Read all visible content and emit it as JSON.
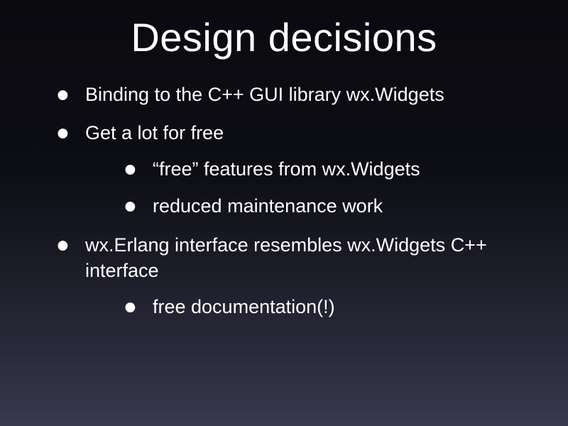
{
  "slide": {
    "title": "Design decisions",
    "bullets": [
      {
        "text": "Binding to the C++ GUI library wx.Widgets",
        "children": []
      },
      {
        "text": "Get a lot for free",
        "children": [
          {
            "text": "“free” features from wx.Widgets"
          },
          {
            "text": "reduced maintenance work"
          }
        ]
      },
      {
        "text": "wx.Erlang interface resembles wx.Widgets C++ interface",
        "children": [
          {
            "text": "free documentation(!)"
          }
        ]
      }
    ]
  }
}
